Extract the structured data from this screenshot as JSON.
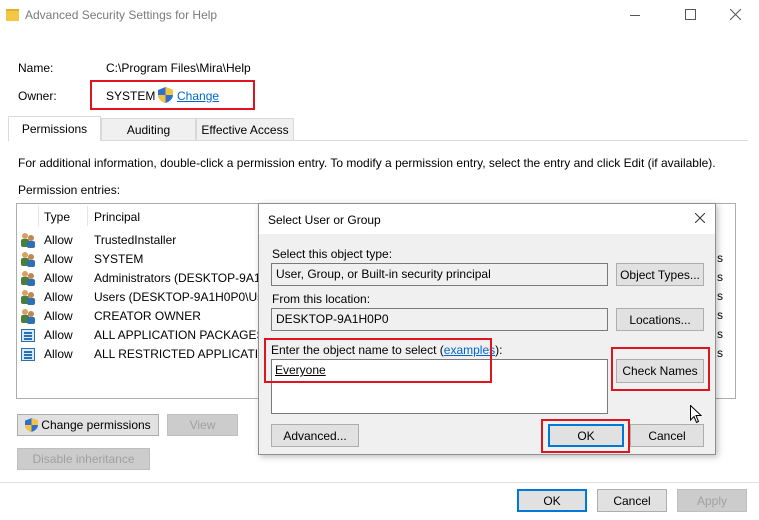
{
  "window": {
    "title": "Advanced Security Settings for Help"
  },
  "info": {
    "name_label": "Name:",
    "name_value": "C:\\Program Files\\Mira\\Help",
    "owner_label": "Owner:",
    "owner_value": "SYSTEM",
    "change_link": "Change"
  },
  "tabs": [
    {
      "label": "Permissions"
    },
    {
      "label": "Auditing"
    },
    {
      "label": "Effective Access"
    }
  ],
  "instructions": "For additional information, double-click a permission entry. To modify a permission entry, select the entry and click Edit (if available).",
  "entries_label": "Permission entries:",
  "table": {
    "headers": {
      "type": "Type",
      "principal": "Principal"
    },
    "rows": [
      {
        "type": "Allow",
        "principal": "TrustedInstaller",
        "icon": "user-group-icon"
      },
      {
        "type": "Allow",
        "principal": "SYSTEM",
        "icon": "user-group-icon"
      },
      {
        "type": "Allow",
        "principal": "Administrators (DESKTOP-9A1...",
        "icon": "user-group-icon"
      },
      {
        "type": "Allow",
        "principal": "Users (DESKTOP-9A1H0P0\\Us...",
        "icon": "user-group-icon"
      },
      {
        "type": "Allow",
        "principal": "CREATOR OWNER",
        "icon": "user-group-icon"
      },
      {
        "type": "Allow",
        "principal": "ALL APPLICATION PACKAGES",
        "icon": "app-package-icon"
      },
      {
        "type": "Allow",
        "principal": "ALL RESTRICTED APPLICATIO...",
        "icon": "app-package-icon"
      }
    ],
    "right_fragments": [
      "s",
      "s",
      "s",
      "s",
      "s",
      "s"
    ]
  },
  "buttons": {
    "change_permissions": "Change permissions",
    "view": "View",
    "disable_inheritance": "Disable inheritance",
    "ok": "OK",
    "cancel": "Cancel",
    "apply": "Apply"
  },
  "dialog": {
    "title": "Select User or Group",
    "object_type_label": "Select this object type:",
    "object_type_value": "User, Group, or Built-in security principal",
    "object_types_button": "Object Types...",
    "location_label": "From this location:",
    "location_value": "DESKTOP-9A1H0P0",
    "locations_button": "Locations...",
    "enter_label_prefix": "Enter the object name to select (",
    "examples_link": "examples",
    "enter_label_suffix": "):",
    "object_name_value": "Everyone",
    "check_names_button": "Check Names",
    "advanced_button": "Advanced...",
    "ok_button": "OK",
    "cancel_button": "Cancel"
  },
  "colors": {
    "accent": "#0078d7",
    "highlight": "#e0141e",
    "link": "#0066cc"
  }
}
